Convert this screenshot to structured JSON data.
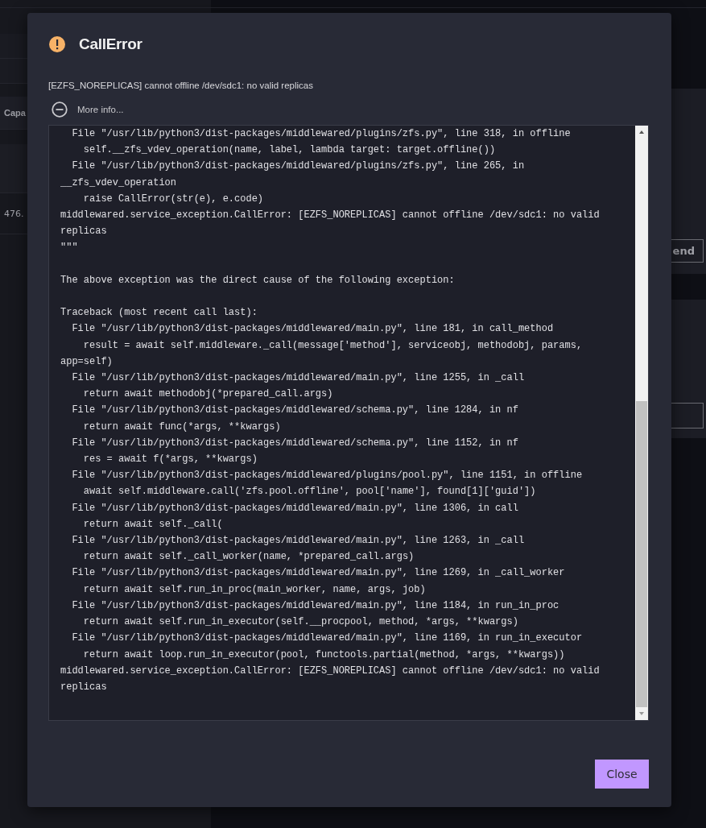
{
  "background": {
    "column_header": "Capa",
    "cell": "476.",
    "button": "end"
  },
  "dialog": {
    "title": "CallError",
    "message": "[EZFS_NOREPLICAS] cannot offline /dev/sdc1: no valid replicas",
    "details_toggle": {
      "label": "More info...",
      "expanded": true
    },
    "traceback": "  File \"/usr/lib/python3/dist-packages/middlewared/plugins/zfs.py\", line 318, in offline\n    self.__zfs_vdev_operation(name, label, lambda target: target.offline())\n  File \"/usr/lib/python3/dist-packages/middlewared/plugins/zfs.py\", line 265, in __zfs_vdev_operation\n    raise CallError(str(e), e.code)\nmiddlewared.service_exception.CallError: [EZFS_NOREPLICAS] cannot offline /dev/sdc1: no valid replicas\n\"\"\"\n\nThe above exception was the direct cause of the following exception:\n\nTraceback (most recent call last):\n  File \"/usr/lib/python3/dist-packages/middlewared/main.py\", line 181, in call_method\n    result = await self.middleware._call(message['method'], serviceobj, methodobj, params, app=self)\n  File \"/usr/lib/python3/dist-packages/middlewared/main.py\", line 1255, in _call\n    return await methodobj(*prepared_call.args)\n  File \"/usr/lib/python3/dist-packages/middlewared/schema.py\", line 1284, in nf\n    return await func(*args, **kwargs)\n  File \"/usr/lib/python3/dist-packages/middlewared/schema.py\", line 1152, in nf\n    res = await f(*args, **kwargs)\n  File \"/usr/lib/python3/dist-packages/middlewared/plugins/pool.py\", line 1151, in offline\n    await self.middleware.call('zfs.pool.offline', pool['name'], found[1]['guid'])\n  File \"/usr/lib/python3/dist-packages/middlewared/main.py\", line 1306, in call\n    return await self._call(\n  File \"/usr/lib/python3/dist-packages/middlewared/main.py\", line 1263, in _call\n    return await self._call_worker(name, *prepared_call.args)\n  File \"/usr/lib/python3/dist-packages/middlewared/main.py\", line 1269, in _call_worker\n    return await self.run_in_proc(main_worker, name, args, job)\n  File \"/usr/lib/python3/dist-packages/middlewared/main.py\", line 1184, in run_in_proc\n    return await self.run_in_executor(self.__procpool, method, *args, **kwargs)\n  File \"/usr/lib/python3/dist-packages/middlewared/main.py\", line 1169, in run_in_executor\n    return await loop.run_in_executor(pool, functools.partial(method, *args, **kwargs))\nmiddlewared.service_exception.CallError: [EZFS_NOREPLICAS] cannot offline /dev/sdc1: no valid replicas",
    "buttons": [
      {
        "label": "Close"
      }
    ]
  }
}
